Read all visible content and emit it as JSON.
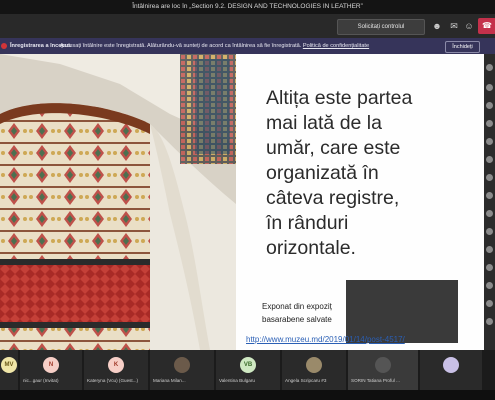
{
  "window": {
    "title": "Întâlnirea are loc în „Section 9.2. DESIGN AND TECHNOLOGIES IN LEATHER”"
  },
  "toolbar": {
    "request_control_label": "Solicitați controlul"
  },
  "banner": {
    "recording_label": "Înregistrarea a început.",
    "message": "Accesați întâlnire este înregistrată. Alăturându-vă sunteți de acord ca întâlnirea să fie înregistrată.",
    "policy_link": "Politică de confidențialitate",
    "close_label": "Închideți"
  },
  "slide": {
    "heading_lines": [
      "Altița este partea",
      "mai lată de la",
      "umăr, care este",
      "organizată în",
      "câteva registre,",
      "în rânduri",
      "orizontale."
    ],
    "caption_lines": [
      "Exponat din expoziț",
      "basarabene salvate"
    ],
    "link": "http://www.muzeu.md/2019/01/14/post-4517/"
  },
  "participants": [
    {
      "initials": "MV",
      "name": "",
      "color": "#f0e6a8"
    },
    {
      "initials": "N",
      "name": "nic...gaur (Invitat)",
      "color": "#f7cfc7"
    },
    {
      "initials": "K",
      "name": "Kateryna (Vcu) (Guest...)",
      "color": "#f7cfc7"
    },
    {
      "initials": "",
      "name": "Mariana Milan...",
      "color": "#6b5a4a"
    },
    {
      "initials": "VB",
      "name": "Valentina Bulgaru",
      "color": "#cfe8c2"
    },
    {
      "initials": "",
      "name": "Angela Scripcaru #3",
      "color": "#9a8a6a"
    },
    {
      "initials": "",
      "name": "SORIN Tatiana Proful ...",
      "color": "#555555"
    },
    {
      "initials": "",
      "name": "",
      "color": "#c9c0e6"
    }
  ]
}
